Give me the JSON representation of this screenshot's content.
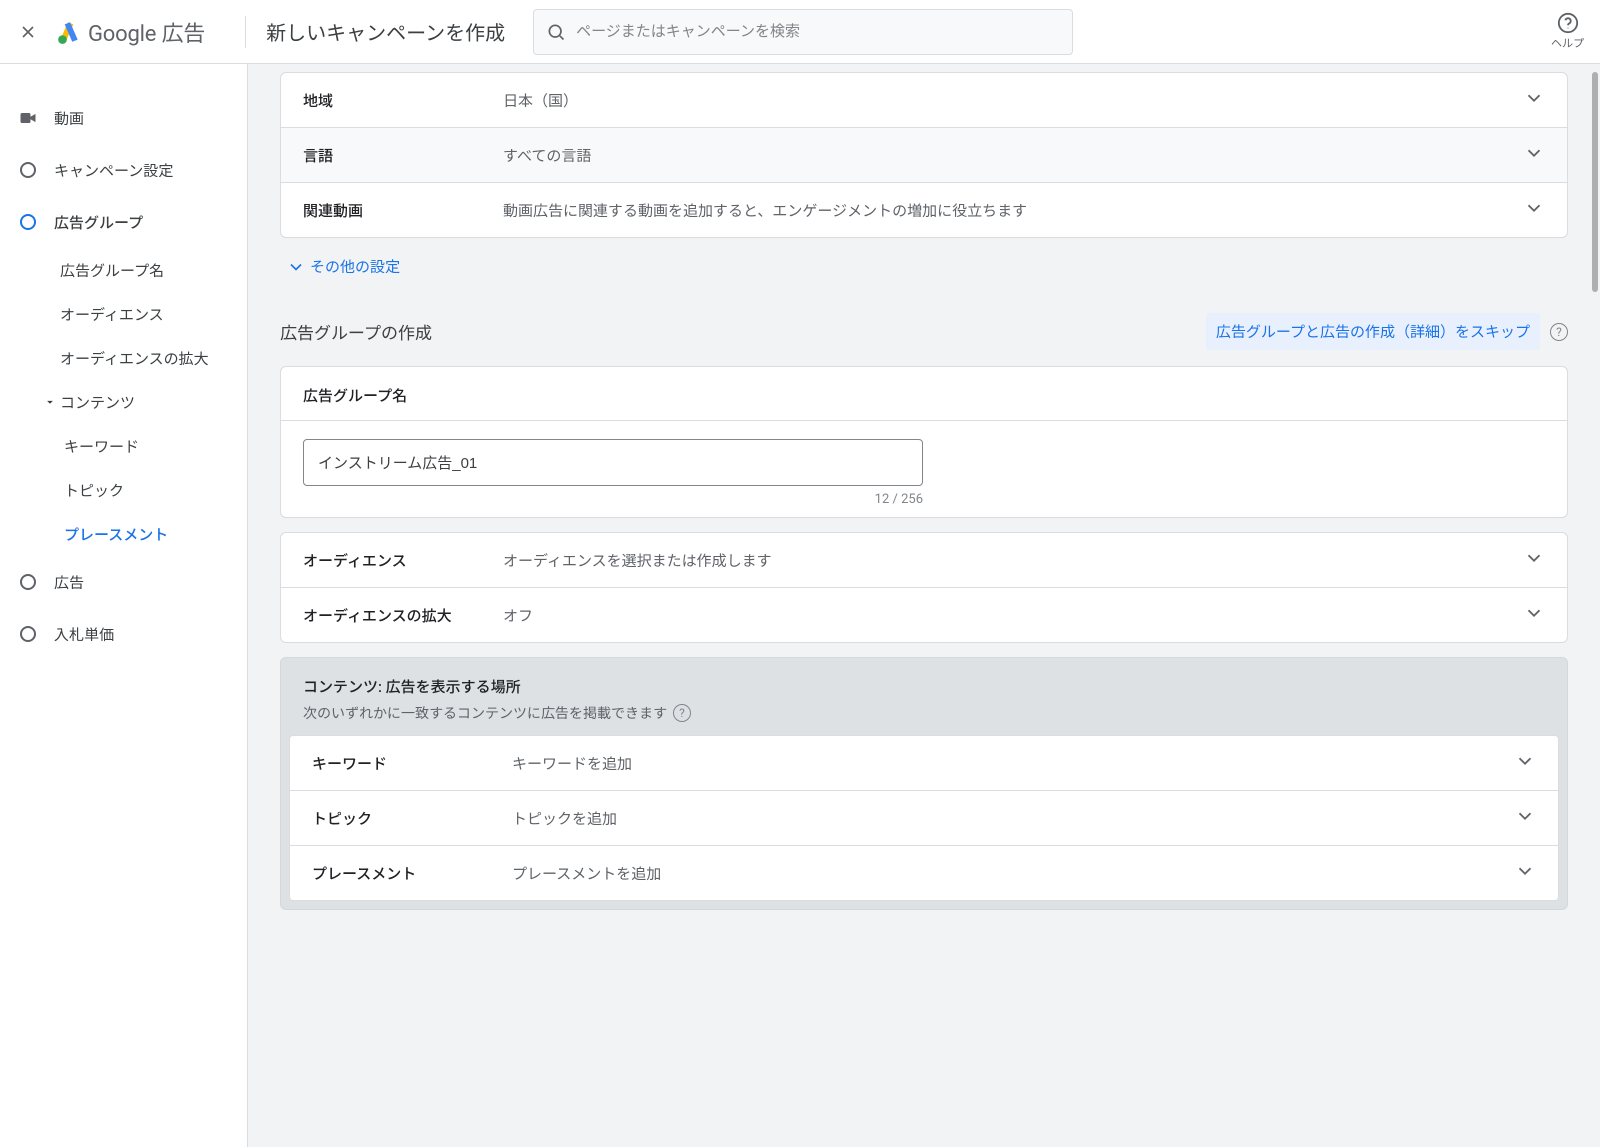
{
  "header": {
    "product_name": "Google 広告",
    "page_title": "新しいキャンペーンを作成",
    "search_placeholder": "ページまたはキャンペーンを検索",
    "help_label": "ヘルプ"
  },
  "sidebar": {
    "video_label": "動画",
    "campaign_settings_label": "キャンペーン設定",
    "ad_group_label": "広告グループ",
    "ad_group_children": {
      "name": "広告グループ名",
      "audience": "オーディエンス",
      "audience_expansion": "オーディエンスの拡大",
      "contents": "コンテンツ",
      "contents_children": {
        "keywords": "キーワード",
        "topics": "トピック",
        "placements": "プレースメント"
      }
    },
    "ads_label": "広告",
    "bid_label": "入札単価"
  },
  "top_rows": {
    "region": {
      "label": "地域",
      "value": "日本（国）"
    },
    "language": {
      "label": "言語",
      "value": "すべての言語"
    },
    "related_videos": {
      "label": "関連動画",
      "value": "動画広告に関連する動画を追加すると、エンゲージメントの増加に役立ちます"
    }
  },
  "more_settings": "その他の設定",
  "section": {
    "title": "広告グループの作成",
    "skip_label": "広告グループと広告の作成（詳細）をスキップ"
  },
  "ad_group_name_card": {
    "header": "広告グループ名",
    "value": "インストリーム広告_01",
    "counter": "12 / 256"
  },
  "audience_row": {
    "label": "オーディエンス",
    "value": "オーディエンスを選択または作成します"
  },
  "audience_exp_row": {
    "label": "オーディエンスの拡大",
    "value": "オフ"
  },
  "content_section": {
    "title": "コンテンツ: 広告を表示する場所",
    "subtitle": "次のいずれかに一致するコンテンツに広告を掲載できます",
    "rows": {
      "keywords": {
        "label": "キーワード",
        "value": "キーワードを追加"
      },
      "topics": {
        "label": "トピック",
        "value": "トピックを追加"
      },
      "placements": {
        "label": "プレースメント",
        "value": "プレースメントを追加"
      }
    }
  }
}
